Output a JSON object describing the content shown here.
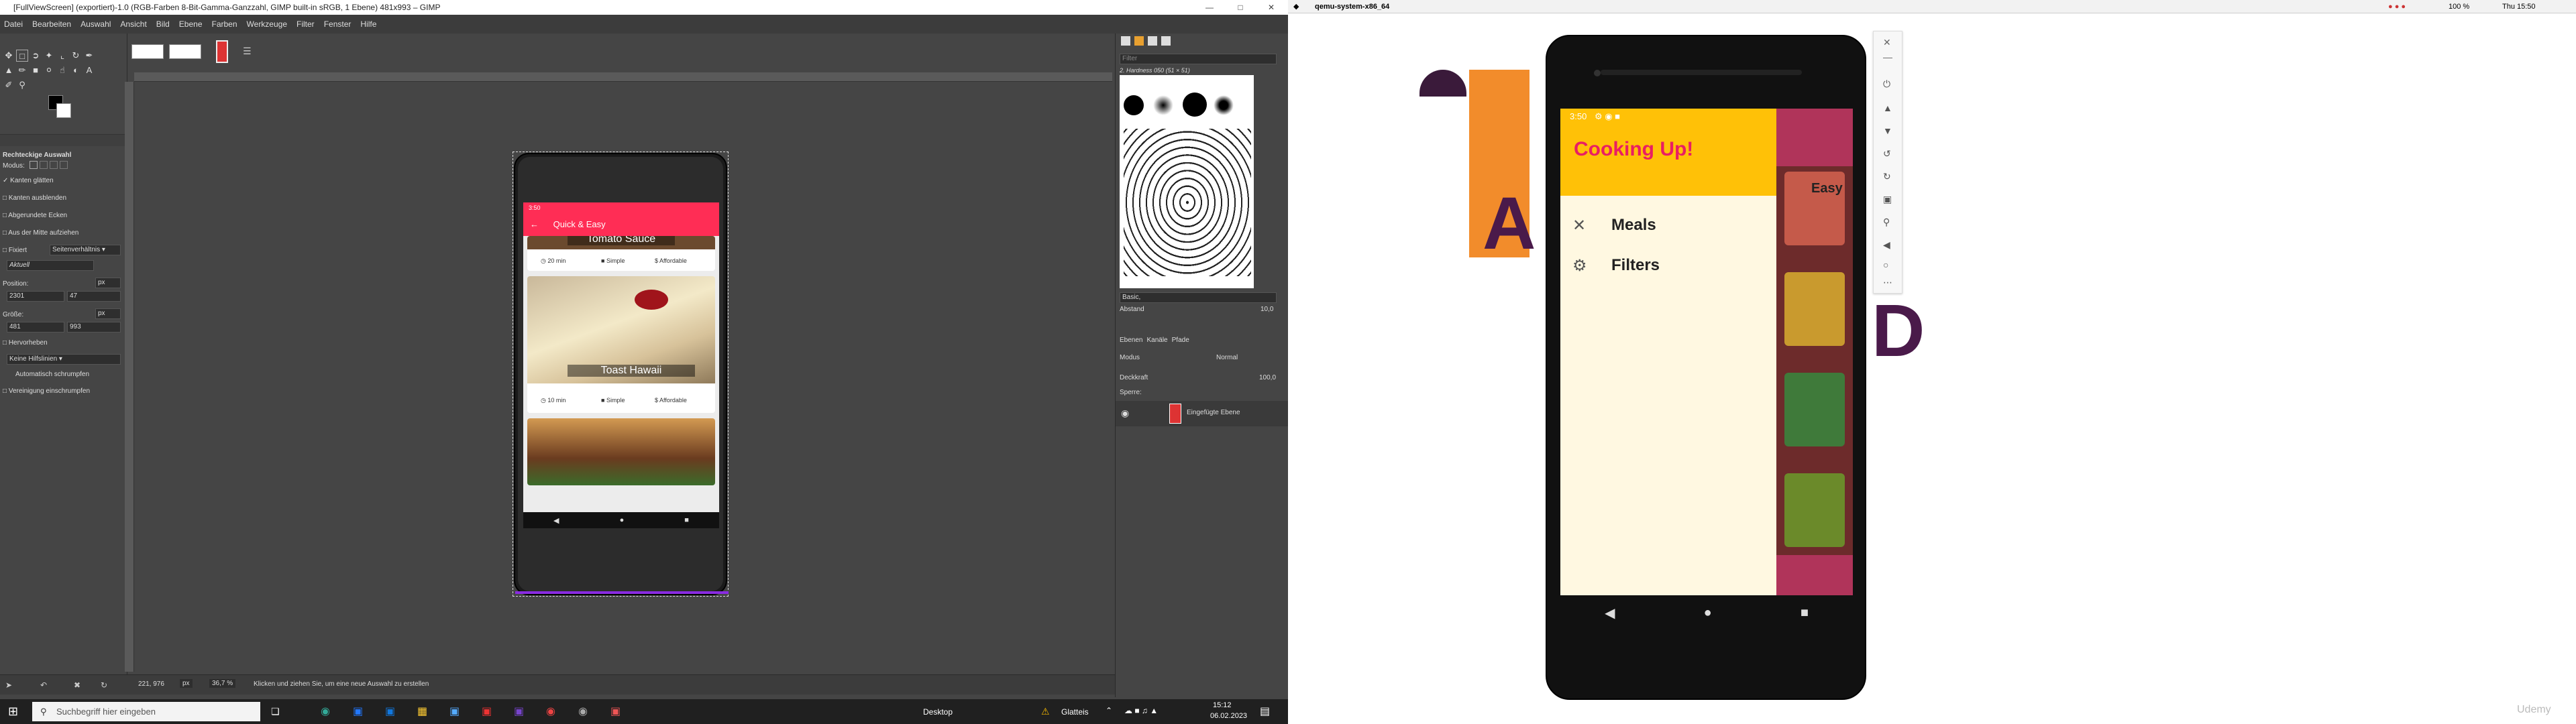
{
  "gimp": {
    "title": "[FullViewScreen] (exportiert)-1.0 (RGB-Farben 8-Bit-Gamma-Ganzzahl, GIMP built-in sRGB, 1 Ebene) 481x993 – GIMP",
    "menu": [
      "Datei",
      "Bearbeiten",
      "Auswahl",
      "Ansicht",
      "Bild",
      "Ebene",
      "Farben",
      "Werkzeuge",
      "Filter",
      "Fenster",
      "Hilfe"
    ],
    "tool_options": {
      "title": "Rechteckige Auswahl",
      "mode_label": "Modus:",
      "antialias": "Kanten glätten",
      "feather": "Kanten ausblenden",
      "rounded": "Abgerundete Ecken",
      "expand_center": "Aus der Mitte aufziehen",
      "fixed_label": "Fixiert",
      "fixed_value": "Seitenverhältnis",
      "ratio_value": "Aktuell",
      "position_label": "Position:",
      "position_unit": "px",
      "pos_x": "2301",
      "pos_y": "47",
      "size_label": "Größe:",
      "size_unit": "px",
      "size_w": "481",
      "size_h": "993",
      "highlight": "Hervorheben",
      "guides": "Keine Hilfslinien",
      "autoshrink": "Automatisch schrumpfen",
      "merged": "Vereinigung einschrumpfen"
    },
    "status": {
      "coords": "221, 976",
      "unit": "px",
      "zoom": "36,7 %",
      "message": "Klicken und ziehen Sie, um eine neue Auswahl zu erstellen"
    },
    "brushes": {
      "filter_placeholder": "Filter",
      "brush_name": "2. Hardness 050 (51 × 51)",
      "preset": "Basic,",
      "spacing_label": "Abstand",
      "spacing_value": "10,0"
    },
    "layers": {
      "tabs": [
        "Ebenen",
        "Kanäle",
        "Pfade"
      ],
      "mode_label": "Modus",
      "mode_value": "Normal",
      "opacity_label": "Deckkraft",
      "opacity_value": "100,0",
      "lock_label": "Sperre:",
      "layer_name": "Eingefügte Ebene"
    }
  },
  "canvas_phone": {
    "time": "3:50",
    "appbar_title": "Quick & Easy",
    "cards": [
      {
        "title": "Tomato Sauce",
        "duration": "20 min",
        "complexity": "Simple",
        "affordability": "Affordable"
      },
      {
        "title": "Toast Hawaii",
        "duration": "10 min",
        "complexity": "Simple",
        "affordability": "Affordable"
      }
    ]
  },
  "qemu": {
    "title": "qemu-system-x86_64",
    "menubar_right": {
      "battery": "100 %",
      "clock": "Thu 15:50"
    },
    "phone": {
      "time": "3:50",
      "drawer_title": "Cooking Up!",
      "items": [
        {
          "label": "Meals"
        },
        {
          "label": "Filters"
        }
      ],
      "behind_card_text": "Easy"
    },
    "watermark": "Udemy"
  },
  "taskbar": {
    "search_placeholder": "Suchbegriff hier eingeben",
    "desktop_label": "Desktop",
    "weather": "Glatteis",
    "time": "15:12",
    "date": "06.02.2023"
  },
  "colors": {
    "accent_pink": "#ff2d55",
    "drawer_yellow": "#ffc107",
    "drawer_bg": "#fff8e1",
    "title_pink": "#e91e63",
    "taskbar": "#202020",
    "gimp_bg": "#454545"
  }
}
